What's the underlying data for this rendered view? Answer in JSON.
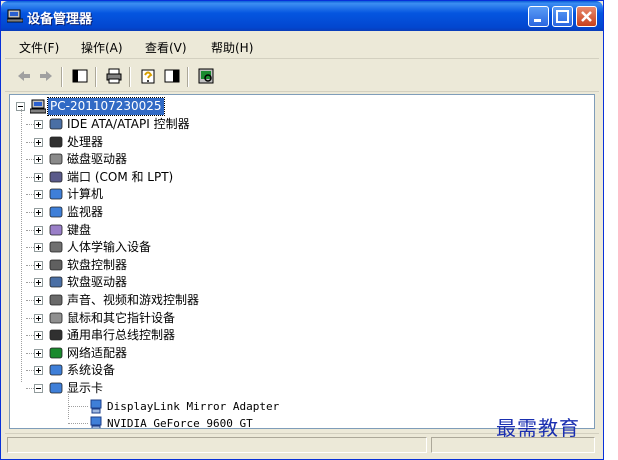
{
  "window": {
    "title": "设备管理器"
  },
  "menubar": {
    "items": [
      "文件(F)",
      "操作(A)",
      "查看(V)",
      "帮助(H)"
    ]
  },
  "tree": {
    "root": "PC-201107230025",
    "categories": [
      {
        "label": "IDE ATA/ATAPI 控制器",
        "icon": "ide-icon"
      },
      {
        "label": "处理器",
        "icon": "cpu-icon"
      },
      {
        "label": "磁盘驱动器",
        "icon": "disk-icon"
      },
      {
        "label": "端口 (COM 和 LPT)",
        "icon": "port-icon"
      },
      {
        "label": "计算机",
        "icon": "computer-icon"
      },
      {
        "label": "监视器",
        "icon": "monitor-icon"
      },
      {
        "label": "键盘",
        "icon": "keyboard-icon"
      },
      {
        "label": "人体学输入设备",
        "icon": "hid-icon"
      },
      {
        "label": "软盘控制器",
        "icon": "floppy-controller-icon"
      },
      {
        "label": "软盘驱动器",
        "icon": "floppy-drive-icon"
      },
      {
        "label": "声音、视频和游戏控制器",
        "icon": "sound-icon"
      },
      {
        "label": "鼠标和其它指针设备",
        "icon": "mouse-icon"
      },
      {
        "label": "通用串行总线控制器",
        "icon": "usb-icon"
      },
      {
        "label": "网络适配器",
        "icon": "network-icon"
      },
      {
        "label": "系统设备",
        "icon": "system-icon"
      },
      {
        "label": "显示卡",
        "icon": "display-icon"
      }
    ],
    "display_children": [
      "DisplayLink Mirror Adapter",
      "NVIDIA GeForce 9600 GT"
    ]
  },
  "watermark": "最需教育"
}
